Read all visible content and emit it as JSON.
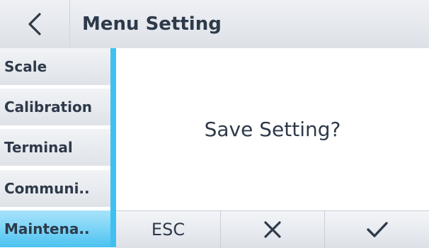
{
  "header": {
    "back_icon": "chevron-left-icon",
    "title": "Menu Setting"
  },
  "sidebar": {
    "items": [
      {
        "label": "Scale",
        "active": false
      },
      {
        "label": "Calibration",
        "active": false
      },
      {
        "label": "Terminal",
        "active": false
      },
      {
        "label": "Communi..",
        "active": false
      },
      {
        "label": "Maintena..",
        "active": true
      }
    ]
  },
  "dialog": {
    "message": "Save Setting?"
  },
  "softkeys": {
    "esc_label": "ESC",
    "cancel_icon": "close-icon",
    "confirm_icon": "check-icon"
  },
  "colors": {
    "accent": "#3fc0f0",
    "text": "#2e3a4a"
  }
}
